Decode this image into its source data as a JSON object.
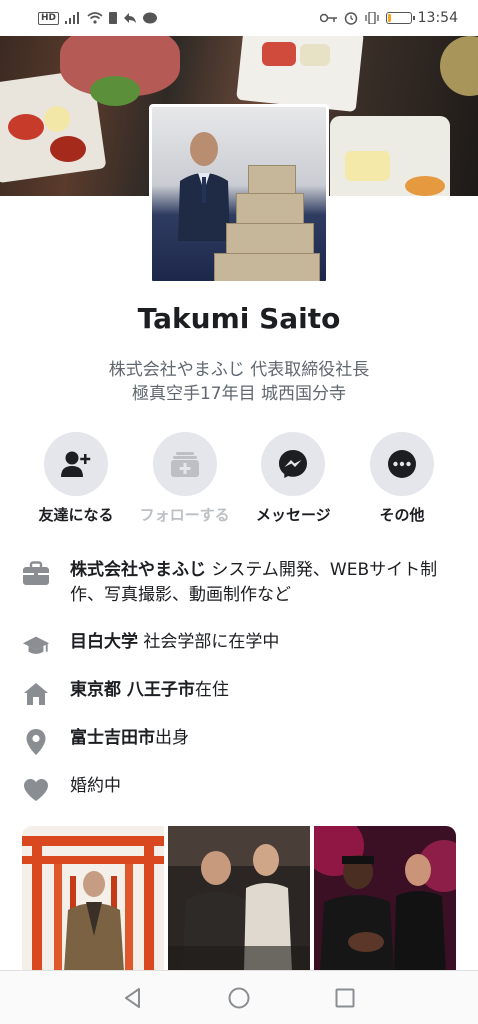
{
  "status_bar": {
    "hd": "HD",
    "time": "13:54",
    "battery_percent": 15
  },
  "profile": {
    "name": "Takumi Saito",
    "bio_line1": "株式会社やまふじ 代表取締役社長",
    "bio_line2": "極真空手17年目 城西国分寺"
  },
  "actions": [
    {
      "label": "友達になる",
      "icon": "add-friend-icon",
      "enabled": true
    },
    {
      "label": "フォローする",
      "icon": "follow-icon",
      "enabled": false
    },
    {
      "label": "メッセージ",
      "icon": "messenger-icon",
      "enabled": true
    },
    {
      "label": "その他",
      "icon": "more-icon",
      "enabled": true
    }
  ],
  "info": {
    "work_bold": "株式会社やまふじ",
    "work_rest": " システム開発、WEBサイト制作、写真撮影、動画制作など",
    "education_bold": "目白大学",
    "education_rest": " 社会学部に在学中",
    "home_bold": "東京都 八王子市",
    "home_rest": "在住",
    "hometown_bold": "富士吉田市",
    "hometown_rest": "出身",
    "relationship": "婚約中"
  },
  "colors": {
    "icon_gray": "#8a8d91",
    "action_bg": "#e4e6eb",
    "secondary_text": "#606770"
  }
}
